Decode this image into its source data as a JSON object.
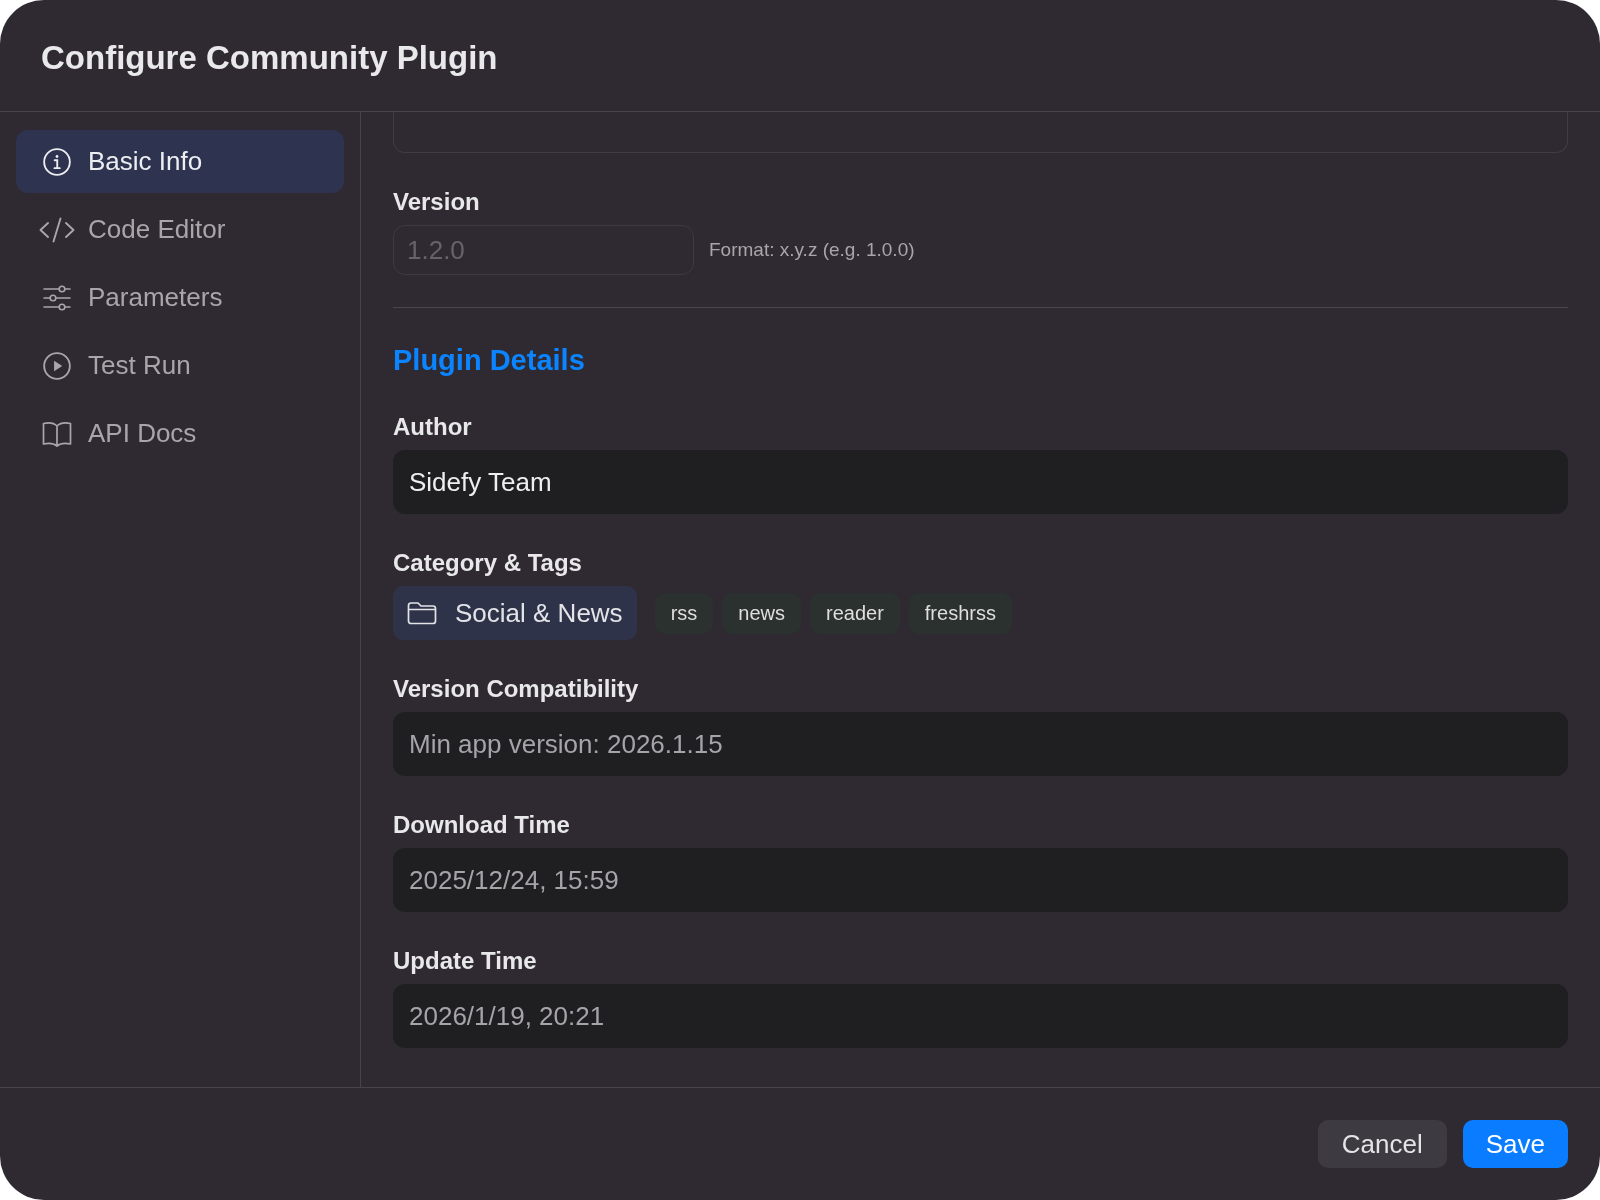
{
  "window": {
    "title": "Configure Community Plugin"
  },
  "sidebar": {
    "items": [
      {
        "label": "Basic Info",
        "selected": true
      },
      {
        "label": "Code Editor",
        "selected": false
      },
      {
        "label": "Parameters",
        "selected": false
      },
      {
        "label": "Test Run",
        "selected": false
      },
      {
        "label": "API Docs",
        "selected": false
      }
    ]
  },
  "content": {
    "sections": [
      {
        "kind": "textarea"
      },
      {
        "kind": "input",
        "label": "Version",
        "value": "1.2.0",
        "disabled": true,
        "readonly": false,
        "hint": "Format: x.y.z (e.g. 1.0.0)"
      },
      {
        "kind": "divider"
      },
      {
        "kind": "heading",
        "text": "Plugin Details"
      },
      {
        "kind": "input",
        "label": "Author",
        "value": "Sidefy Team",
        "disabled": false,
        "readonly": false
      },
      {
        "kind": "category",
        "label": "Category & Tags",
        "category": "Social & News",
        "tags": [
          "rss",
          "news",
          "reader",
          "freshrss"
        ]
      },
      {
        "kind": "input",
        "label": "Version Compatibility",
        "value": "Min app version: 2026.1.15",
        "disabled": false,
        "readonly": true
      },
      {
        "kind": "input",
        "label": "Download Time",
        "value": "2025/12/24, 15:59",
        "disabled": false,
        "readonly": true
      },
      {
        "kind": "input",
        "label": "Update Time",
        "value": "2026/1/19, 20:21",
        "disabled": false,
        "readonly": true
      }
    ]
  },
  "footer": {
    "buttons": [
      {
        "label": "Cancel",
        "kind": "secondary"
      },
      {
        "label": "Save",
        "kind": "primary"
      }
    ]
  }
}
